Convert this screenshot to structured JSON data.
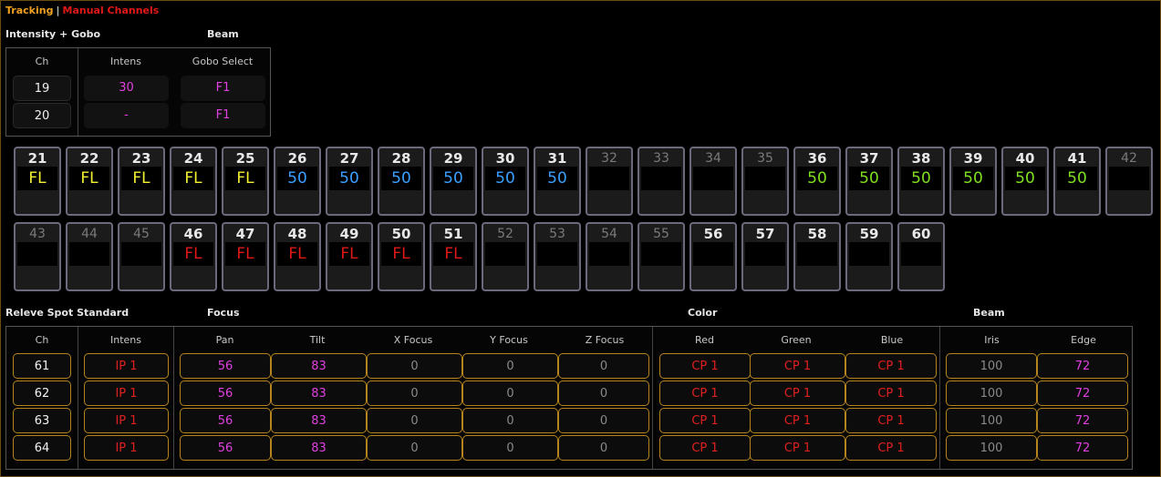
{
  "title": {
    "mode": "Tracking",
    "separator": "|",
    "view": "Manual Channels"
  },
  "intensity_gobo": {
    "section_label": "Intensity + Gobo",
    "beam_label": "Beam",
    "headers": {
      "ch": "Ch",
      "intens": "Intens",
      "gobo": "Gobo Select"
    },
    "rows": [
      {
        "ch": "19",
        "intens": "30",
        "gobo": "F1"
      },
      {
        "ch": "20",
        "intens": "-",
        "gobo": "F1"
      }
    ]
  },
  "channel_rows": [
    [
      {
        "num": "21",
        "val": "FL",
        "color": "yellow",
        "active": true
      },
      {
        "num": "22",
        "val": "FL",
        "color": "yellow",
        "active": true
      },
      {
        "num": "23",
        "val": "FL",
        "color": "yellow",
        "active": true
      },
      {
        "num": "24",
        "val": "FL",
        "color": "yellow",
        "active": true
      },
      {
        "num": "25",
        "val": "FL",
        "color": "yellow",
        "active": true
      },
      {
        "num": "26",
        "val": "50",
        "color": "blue",
        "active": true
      },
      {
        "num": "27",
        "val": "50",
        "color": "blue",
        "active": true
      },
      {
        "num": "28",
        "val": "50",
        "color": "blue",
        "active": true
      },
      {
        "num": "29",
        "val": "50",
        "color": "blue",
        "active": true
      },
      {
        "num": "30",
        "val": "50",
        "color": "blue",
        "active": true
      },
      {
        "num": "31",
        "val": "50",
        "color": "blue",
        "active": true
      },
      {
        "num": "32",
        "val": "",
        "color": "none",
        "active": false
      },
      {
        "num": "33",
        "val": "",
        "color": "none",
        "active": false
      },
      {
        "num": "34",
        "val": "",
        "color": "none",
        "active": false
      },
      {
        "num": "35",
        "val": "",
        "color": "none",
        "active": false
      },
      {
        "num": "36",
        "val": "50",
        "color": "green",
        "active": true
      },
      {
        "num": "37",
        "val": "50",
        "color": "green",
        "active": true
      },
      {
        "num": "38",
        "val": "50",
        "color": "green",
        "active": true
      },
      {
        "num": "39",
        "val": "50",
        "color": "green",
        "active": true
      },
      {
        "num": "40",
        "val": "50",
        "color": "green",
        "active": true
      },
      {
        "num": "41",
        "val": "50",
        "color": "green",
        "active": true
      },
      {
        "num": "42",
        "val": "",
        "color": "none",
        "active": false
      }
    ],
    [
      {
        "num": "43",
        "val": "",
        "color": "none",
        "active": false
      },
      {
        "num": "44",
        "val": "",
        "color": "none",
        "active": false
      },
      {
        "num": "45",
        "val": "",
        "color": "none",
        "active": false
      },
      {
        "num": "46",
        "val": "FL",
        "color": "red",
        "active": true
      },
      {
        "num": "47",
        "val": "FL",
        "color": "red",
        "active": true
      },
      {
        "num": "48",
        "val": "FL",
        "color": "red",
        "active": true
      },
      {
        "num": "49",
        "val": "FL",
        "color": "red",
        "active": true
      },
      {
        "num": "50",
        "val": "FL",
        "color": "red",
        "active": true
      },
      {
        "num": "51",
        "val": "FL",
        "color": "red",
        "active": true
      },
      {
        "num": "52",
        "val": "",
        "color": "none",
        "active": false
      },
      {
        "num": "53",
        "val": "",
        "color": "none",
        "active": false
      },
      {
        "num": "54",
        "val": "",
        "color": "none",
        "active": false
      },
      {
        "num": "55",
        "val": "",
        "color": "none",
        "active": false
      },
      {
        "num": "56",
        "val": "",
        "color": "none",
        "active": true
      },
      {
        "num": "57",
        "val": "",
        "color": "none",
        "active": true
      },
      {
        "num": "58",
        "val": "",
        "color": "none",
        "active": true
      },
      {
        "num": "59",
        "val": "",
        "color": "none",
        "active": true
      },
      {
        "num": "60",
        "val": "",
        "color": "none",
        "active": true
      }
    ]
  ],
  "releve": {
    "section_label": "Releve Spot Standard",
    "groups": {
      "focus": "Focus",
      "color": "Color",
      "beam": "Beam"
    },
    "headers": {
      "ch": "Ch",
      "intens": "Intens",
      "pan": "Pan",
      "tilt": "Tilt",
      "xfocus": "X Focus",
      "yfocus": "Y Focus",
      "zfocus": "Z Focus",
      "red": "Red",
      "green": "Green",
      "blue": "Blue",
      "iris": "Iris",
      "edge": "Edge"
    },
    "rows": [
      {
        "ch": "61",
        "intens": "IP 1",
        "pan": "56",
        "tilt": "83",
        "xfocus": "0",
        "yfocus": "0",
        "zfocus": "0",
        "red": "CP 1",
        "green": "CP 1",
        "blue": "CP 1",
        "iris": "100",
        "edge": "72"
      },
      {
        "ch": "62",
        "intens": "IP 1",
        "pan": "56",
        "tilt": "83",
        "xfocus": "0",
        "yfocus": "0",
        "zfocus": "0",
        "red": "CP 1",
        "green": "CP 1",
        "blue": "CP 1",
        "iris": "100",
        "edge": "72"
      },
      {
        "ch": "63",
        "intens": "IP 1",
        "pan": "56",
        "tilt": "83",
        "xfocus": "0",
        "yfocus": "0",
        "zfocus": "0",
        "red": "CP 1",
        "green": "CP 1",
        "blue": "CP 1",
        "iris": "100",
        "edge": "72"
      },
      {
        "ch": "64",
        "intens": "IP 1",
        "pan": "56",
        "tilt": "83",
        "xfocus": "0",
        "yfocus": "0",
        "zfocus": "0",
        "red": "CP 1",
        "green": "CP 1",
        "blue": "CP 1",
        "iris": "100",
        "edge": "72"
      }
    ]
  },
  "colors": {
    "accent_orange": "#f0a020",
    "accent_red": "#e01818",
    "level_yellow": "#f2f030",
    "level_blue": "#3aa0ff",
    "level_green": "#80e020",
    "value_magenta": "#e040e0",
    "cell_border_gold": "#b5841e"
  }
}
